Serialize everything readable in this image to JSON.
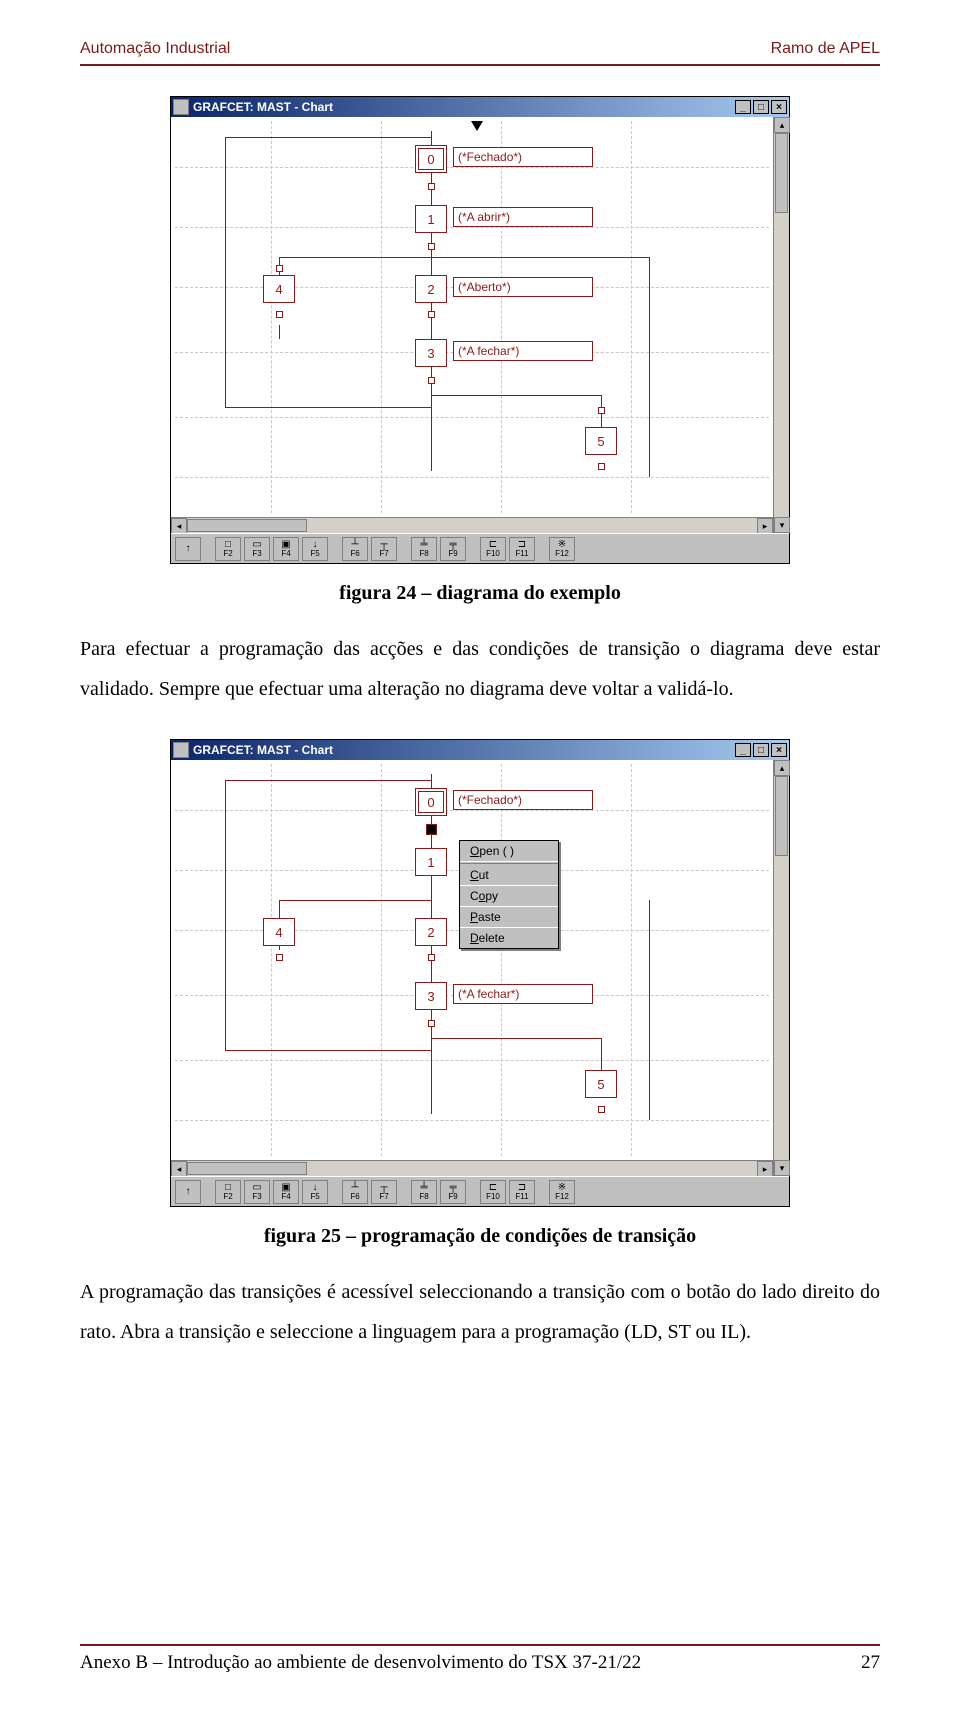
{
  "header": {
    "left": "Automação Industrial",
    "right": "Ramo de APEL"
  },
  "fig1": {
    "title": "GRAFCET: MAST - Chart",
    "steps": {
      "s0": "0",
      "s1": "1",
      "s2": "2",
      "s3": "3",
      "s4": "4",
      "s5": "5"
    },
    "labels": {
      "l0": "(*Fechado*)",
      "l1": "(*A abrir*)",
      "l2": "(*Aberto*)",
      "l3": "(*A fechar*)"
    },
    "caption": "figura 24 – diagrama do exemplo",
    "fkeys": [
      "↑",
      "F2",
      "F3",
      "F4",
      "F5",
      "F6",
      "F7",
      "F8",
      "F9",
      "F10",
      "F11",
      "F12"
    ]
  },
  "para1": "Para efectuar a programação das acções e das condições de transição o diagrama deve estar validado. Sempre que efectuar uma alteração no diagrama deve voltar a validá-lo.",
  "fig2": {
    "title": "GRAFCET: MAST - Chart",
    "steps": {
      "s0": "0",
      "s1": "1",
      "s2": "2",
      "s3": "3",
      "s4": "4",
      "s5": "5"
    },
    "labels": {
      "l0": "(*Fechado*)",
      "l3": "(*A fechar*)"
    },
    "menu": {
      "open": "Open ( )",
      "cut": "Cut",
      "copy": "Copy",
      "paste": "Paste",
      "delete": "Delete"
    },
    "caption": "figura 25 – programação de condições de transição",
    "fkeys": [
      "↑",
      "F2",
      "F3",
      "F4",
      "F5",
      "F6",
      "F7",
      "F8",
      "F9",
      "F10",
      "F11",
      "F12"
    ]
  },
  "para2": "A programação das transições é acessível seleccionando a transição com o botão do lado direito do rato. Abra a transição e seleccione a linguagem para a programação (LD, ST ou IL).",
  "footer": {
    "left": "Anexo B – Introdução ao ambiente de desenvolvimento do TSX 37-21/22",
    "right": "27"
  }
}
